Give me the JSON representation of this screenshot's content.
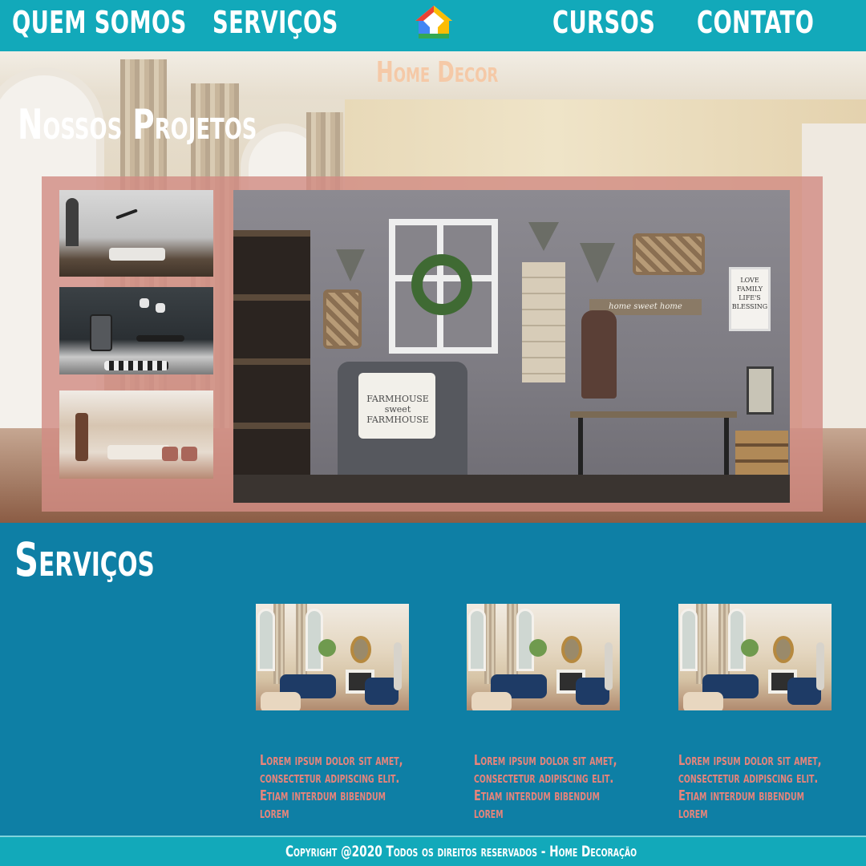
{
  "nav": {
    "items": [
      {
        "label": "QUEM SOMOS"
      },
      {
        "label": "SERVIÇOS"
      },
      {
        "label": "CURSOS"
      },
      {
        "label": "CONTATO"
      }
    ],
    "logo_icon": "home-logo-icon"
  },
  "hero": {
    "brand": "Home Decor",
    "projects_title": "Nossos Projetos",
    "main_image": {
      "pillow_text": "FARMHOUSE sweet FARMHOUSE",
      "home_sign_text": "home sweet home",
      "love_sign_text": "LOVE FAMILY LIFE'S BLESSING"
    }
  },
  "services": {
    "title": "Serviços",
    "cards": [
      {
        "text": "Lorem ipsum dolor sit amet, consectetur adipiscing elit. Etiam interdum bibendum lorem"
      },
      {
        "text": "Lorem ipsum dolor sit amet, consectetur adipiscing elit. Etiam interdum bibendum lorem"
      },
      {
        "text": "Lorem ipsum dolor sit amet, consectetur adipiscing elit. Etiam interdum bibendum lorem"
      }
    ]
  },
  "footer": {
    "text": "Copyright @2020 Todos os direitos reservados - Home Decoração"
  },
  "colors": {
    "nav_bg": "#12a9ba",
    "services_bg": "#0e7fa5",
    "brand_text": "#f5c9a7",
    "card_text": "#e7847b",
    "frame_pink": "#d28c84"
  }
}
